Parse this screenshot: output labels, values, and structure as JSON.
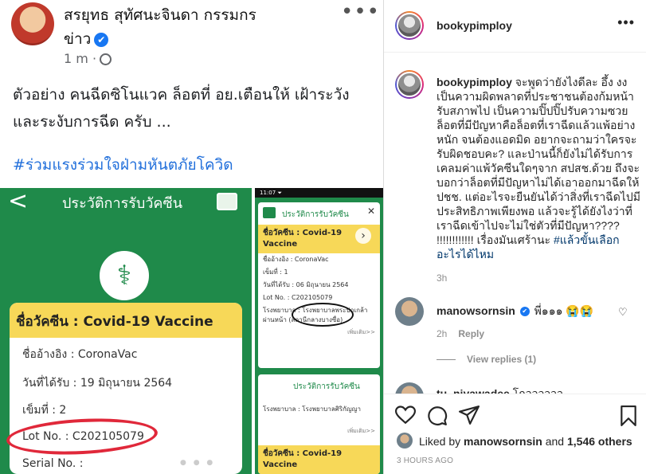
{
  "media": {
    "fb_post": {
      "author_line1": "สรยุทธ สุทัศนะจินดา กรรมกร",
      "author_line2": "ข่าว",
      "verified_mark": "✔",
      "more": "•••",
      "time": "1 m ·",
      "text": "ตัวอย่าง คนฉีดซิโนแวค ล็อตที่ อย.เตือนให้ เฝ้าระวัง และระงับการฉีด ครับ ...",
      "hashtag": "#ร่วมแรงร่วมใจฝ่ามหันตภัยโควิด"
    },
    "vaccine_card": {
      "back": "<",
      "title": "ประวัติการรับวัคซีน",
      "vaccine_name": "ชื่อวัคซีน : Covid-19 Vaccine",
      "reference_name": "ชื่ออ้างอิง : CoronaVac",
      "date_received": "วันที่ได้รับ : 19 มิถุนายน 2564",
      "dose": "เข็มที่ : 2",
      "lot_no": "Lot No. : C202105079",
      "serial_no": "Serial No. :"
    },
    "phone_card": {
      "status_time": "11:07 ⏷",
      "title": "ประวัติการรับวัคซีน",
      "close": "✕",
      "vaccine_name": "ชื่อวัคซีน : Covid-19 Vaccine",
      "reference_name": "ชื่ออ้างอิง : CoronaVac",
      "dose": "เข็มที่ : 1",
      "date_received": "วันที่ได้รับ : 06 มิถุนายน 2564",
      "lot_no": "Lot No. : C202105079",
      "hospital": "โรงพยาบาล : โรงพยาบาลพระปกเกล้าผ่านหน้า (สถานีกลางบางซื่อ)",
      "more_link": "เพิ่มเติม>>",
      "title2": "ประวัติการรับวัคซีน",
      "hospital2": "โรงพยาบาล : โรงพยาบาลศิริกัญญา",
      "more_link2": "เพิ่มเติม>>",
      "vaccine_name2": "ชื่อวัคซีน : Covid-19 Vaccine",
      "next_arrow": "›"
    },
    "carousel_dots": "● ● ●"
  },
  "header": {
    "username": "bookypimploy",
    "more": "•••"
  },
  "caption": {
    "username": "bookypimploy",
    "text": "จะพูดว่ายังไงดีละ อึ้ง งง เป็นความผิดพลาดที่ประชาชนต้องก้มหน้ารับสภาพไป เป็นความปิ๊ปปิ๊ปรับความซวย ล็อตที่มีปัญหาคือล็อตที่เราฉีดแล้วแพ้อย่างหนัก จนต้องแอดมิด อยากจะถามว่าใครจะรับผิดชอบคะ? และป่านนี้ก็ยังไม่ได้รับการเคลมค่าแพ้วัคซีนใดๆจาก สปสช.ด้วย ถึงจะบอกว่าล็อตที่มีปัญหาไม่ได้เอาออกมาฉีดให้ปชช. แต่อะไรจะยืนยันได้ว่าสิ่งที่เราฉีดไปมีประสิทธิภาพเพียงพอ แล้วจะรู้ได้ยังไงว่าที่เราฉีดเข้าไปจะไม่ใช่ตัวที่มีปัญหา???? !!!!!!!!!!!! เรื่องมันเศร้านะ",
    "hashtag": "#แล้วขั้นเลือกอะไรได้ไหม",
    "time": "3h"
  },
  "comments": [
    {
      "username": "manowsornsin",
      "text": "พี่๑๑๑ 😭😭",
      "time": "2h",
      "reply": "Reply",
      "like_icon": "♡"
    }
  ],
  "view_replies": "View replies (1)",
  "partial_comment": {
    "username": "tu_niyawadee",
    "text": "โกวววววว"
  },
  "actions": {
    "liked_by_prefix": "Liked by ",
    "liked_by_user": "manowsornsin",
    "liked_by_and": " and ",
    "liked_by_count": "1,546 others",
    "posted": "3 HOURS AGO"
  }
}
